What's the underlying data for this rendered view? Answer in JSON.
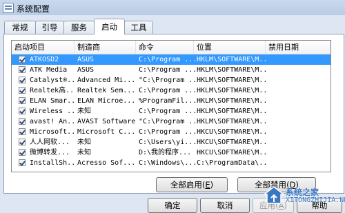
{
  "window": {
    "title": "系统配置"
  },
  "tabs": [
    {
      "label": "常规"
    },
    {
      "label": "引导"
    },
    {
      "label": "服务"
    },
    {
      "label": "启动"
    },
    {
      "label": "工具"
    }
  ],
  "table": {
    "columns": [
      "启动项目",
      "制造商",
      "命令",
      "位置",
      "禁用日期"
    ],
    "rows": [
      [
        "ATKOSD2",
        "ASUS",
        "C:\\Program ...",
        "HKLM\\SOFTWARE\\M...",
        ""
      ],
      [
        "ATK Media",
        "ASUS",
        "C:\\Program ...",
        "HKLM\\SOFTWARE\\M...",
        ""
      ],
      [
        "Catalyst®...",
        "Advanced Mi...",
        "\"C:\\Program ...",
        "HKLM\\SOFTWARE\\M...",
        ""
      ],
      [
        "Realtek高...",
        "Realtek Sem...",
        "C:\\Program ...",
        "HKLM\\SOFTWARE\\M...",
        ""
      ],
      [
        "ELAN Smar...",
        "ELAN Microe...",
        "%ProgramFil...",
        "HKLM\\SOFTWARE\\M...",
        ""
      ],
      [
        "Wireless ...",
        "未知",
        "C:\\Program ...",
        "HKLM\\SOFTWARE\\M...",
        ""
      ],
      [
        "avast! An...",
        "AVAST Software",
        "\"C:\\Program ...",
        "HKLM\\SOFTWARE\\M...",
        ""
      ],
      [
        "Microsoft...",
        "Microsoft C...",
        "C:\\Program ...",
        "HKCU\\SOFTWARE\\M...",
        ""
      ],
      [
        "人人网软...",
        "未知",
        "C:\\Users\\yi...",
        "HKCU\\SOFTWARE\\M...",
        ""
      ],
      [
        "微博转发...",
        "未知",
        "D:\\我的程序...",
        "HKCU\\SOFTWARE\\M...",
        ""
      ],
      [
        "InstallSh...",
        "Acresso Sof...",
        "C:\\Windows\\...",
        "C:\\ProgramData\\...",
        ""
      ]
    ],
    "checked": [
      true,
      true,
      true,
      true,
      true,
      true,
      true,
      true,
      true,
      true,
      true
    ]
  },
  "buttons": {
    "enable_all": "全部启用",
    "enable_all_key": "E",
    "disable_all": "全部禁用",
    "disable_all_key": "D",
    "ok": "确定",
    "cancel": "取消",
    "apply": "应用",
    "apply_key": "A",
    "help": "帮助"
  },
  "watermark": {
    "brand": "系统之家",
    "url": "XITONGZHIJIA.NET"
  },
  "colors": {
    "selection": "#3399ff",
    "window_bg": "#dde6f2"
  }
}
